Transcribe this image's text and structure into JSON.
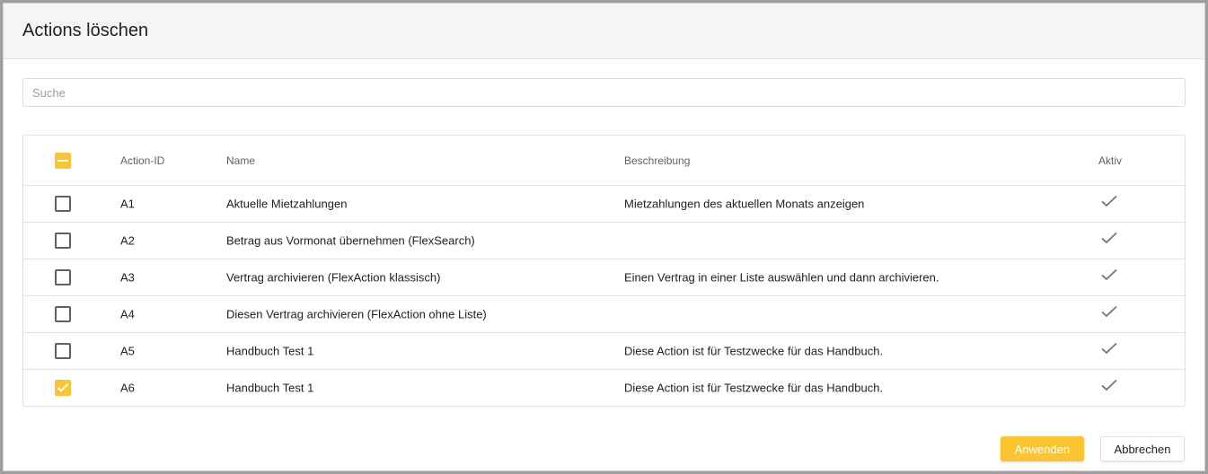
{
  "dialog": {
    "title": "Actions löschen",
    "search_placeholder": "Suche"
  },
  "table": {
    "headers": {
      "id": "Action-ID",
      "name": "Name",
      "description": "Beschreibung",
      "active": "Aktiv"
    },
    "select_all_state": "indeterminate",
    "rows": [
      {
        "id": "A1",
        "name": "Aktuelle Mietzahlungen",
        "description": "Mietzahlungen des aktuellen Monats anzeigen",
        "active": true,
        "selected": false
      },
      {
        "id": "A2",
        "name": "Betrag aus Vormonat übernehmen (FlexSearch)",
        "description": "",
        "active": true,
        "selected": false
      },
      {
        "id": "A3",
        "name": "Vertrag archivieren (FlexAction klassisch)",
        "description": "Einen Vertrag in einer Liste auswählen und dann archivieren.",
        "active": true,
        "selected": false
      },
      {
        "id": "A4",
        "name": "Diesen Vertrag archivieren (FlexAction ohne Liste)",
        "description": "",
        "active": true,
        "selected": false
      },
      {
        "id": "A5",
        "name": "Handbuch Test 1",
        "description": "Diese Action ist für Testzwecke für das Handbuch.",
        "active": true,
        "selected": false
      },
      {
        "id": "A6",
        "name": "Handbuch Test 1",
        "description": "Diese Action ist für Testzwecke für das Handbuch.",
        "active": true,
        "selected": true
      }
    ]
  },
  "footer": {
    "apply_label": "Anwenden",
    "cancel_label": "Abbrechen"
  },
  "colors": {
    "accent": "#fbc531",
    "header_bg": "#f5f5f5",
    "check_icon": "#757575"
  }
}
